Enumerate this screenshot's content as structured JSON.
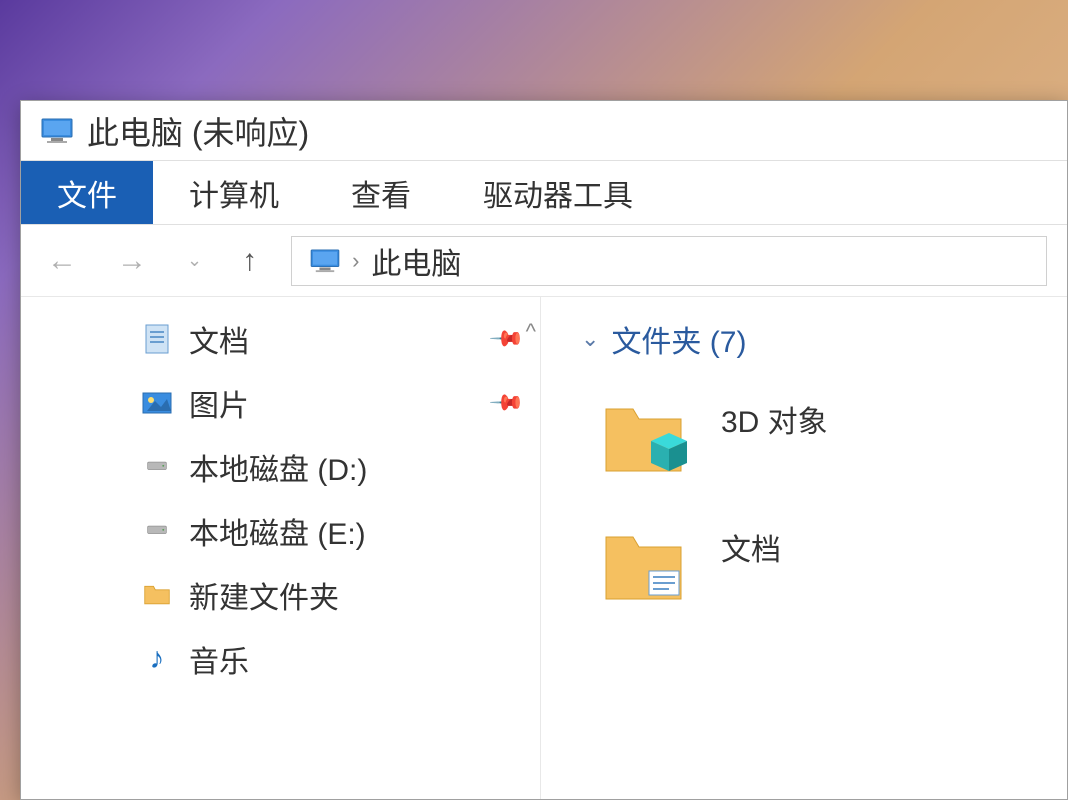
{
  "titlebar": {
    "title": "此电脑 (未响应)"
  },
  "menubar": {
    "items": [
      {
        "label": "文件",
        "active": true
      },
      {
        "label": "计算机",
        "active": false
      },
      {
        "label": "查看",
        "active": false
      },
      {
        "label": "驱动器工具",
        "active": false
      }
    ]
  },
  "breadcrumb": {
    "location": "此电脑"
  },
  "sidebar": {
    "items": [
      {
        "label": "文档",
        "icon": "document",
        "pinned": true,
        "caret": true
      },
      {
        "label": "图片",
        "icon": "pictures",
        "pinned": true
      },
      {
        "label": "本地磁盘 (D:)",
        "icon": "drive"
      },
      {
        "label": "本地磁盘 (E:)",
        "icon": "drive"
      },
      {
        "label": "新建文件夹",
        "icon": "folder"
      },
      {
        "label": "音乐",
        "icon": "music"
      }
    ]
  },
  "content": {
    "group_header": "文件夹 (7)",
    "folders": [
      {
        "label": "3D 对象",
        "icon": "3dobjects"
      },
      {
        "label": "文档",
        "icon": "documents"
      }
    ]
  }
}
